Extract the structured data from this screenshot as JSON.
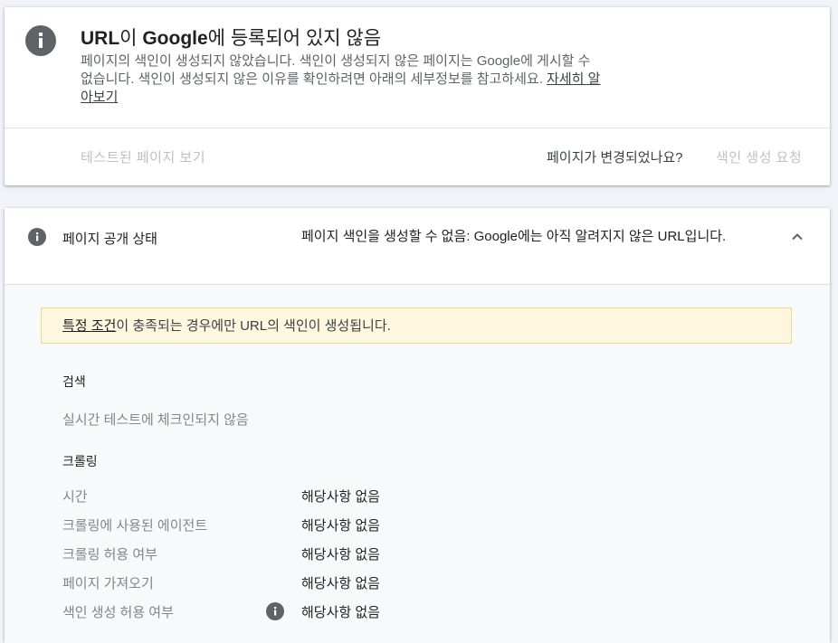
{
  "status_card": {
    "title_part1": "URL",
    "title_part2": "이 ",
    "title_part3": "Google",
    "title_part4": "에 등록되어 있지 않음",
    "description": "페이지의 색인이 생성되지 않았습니다. 색인이 생성되지 않은 페이지는 Google에 게시할 수 없습니다. 색인이 생성되지 않은 이유를 확인하려면 아래의 세부정보를 참고하세요. ",
    "learn_more": "자세히 알아보기",
    "view_tested_page": "테스트된 페이지 보기",
    "page_changed": "페이지가 변경되었나요?",
    "request_indexing": "색인 생성 요청"
  },
  "detail_card": {
    "label": "페이지 공개 상태",
    "value": "페이지 색인을 생성할 수 없음: Google에는 아직 알려지지 않은 URL입니다.",
    "notice_link": "특정 조건",
    "notice_text": "이 충족되는 경우에만 URL의 색인이 생성됩니다.",
    "search": {
      "title": "검색",
      "value": "실시간 테스트에 체크인되지 않음"
    },
    "crawl": {
      "title": "크롤링",
      "rows": [
        {
          "label": "시간",
          "value": "해당사항 없음"
        },
        {
          "label": "크롤링에 사용된 에이전트",
          "value": "해당사항 없음"
        },
        {
          "label": "크롤링 허용 여부",
          "value": "해당사항 없음"
        },
        {
          "label": "페이지 가져오기",
          "value": "해당사항 없음"
        },
        {
          "label": "색인 생성 허용 여부",
          "value": "해당사항 없음"
        }
      ]
    }
  },
  "icons": {
    "status": "info-icon",
    "visibility": "info-icon",
    "collapse": "chevron-up-icon",
    "help": "info-icon"
  },
  "colors": {
    "notice_bg": "#fef7e0",
    "notice_border": "#f2d98a",
    "icon": "#5f6368"
  }
}
